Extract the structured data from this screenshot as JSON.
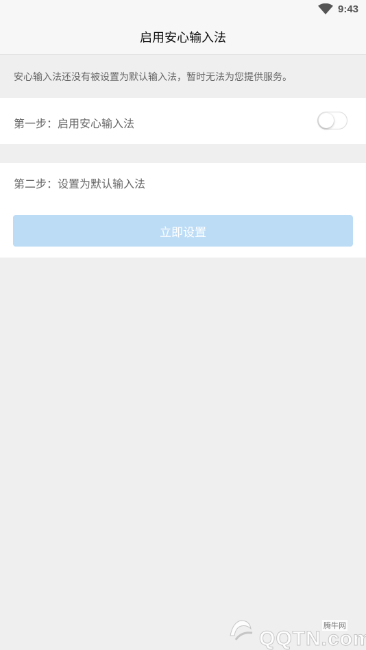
{
  "status_bar": {
    "time": "9:43",
    "wifi_icon": "wifi-icon"
  },
  "header": {
    "title": "启用安心输入法"
  },
  "notice": {
    "text": "安心输入法还没有被设置为默认输入法，暂时无法为您提供服务。"
  },
  "step1": {
    "label": "第一步：启用安心输入法",
    "toggle_on": false
  },
  "step2": {
    "label": "第二步：设置为默认输入法",
    "button_label": "立即设置"
  },
  "watermark": {
    "name": "腾牛网",
    "site": "QQTN.com"
  },
  "colors": {
    "background": "#efefef",
    "panel": "#ffffff",
    "button_disabled": "#bcdcf6"
  }
}
